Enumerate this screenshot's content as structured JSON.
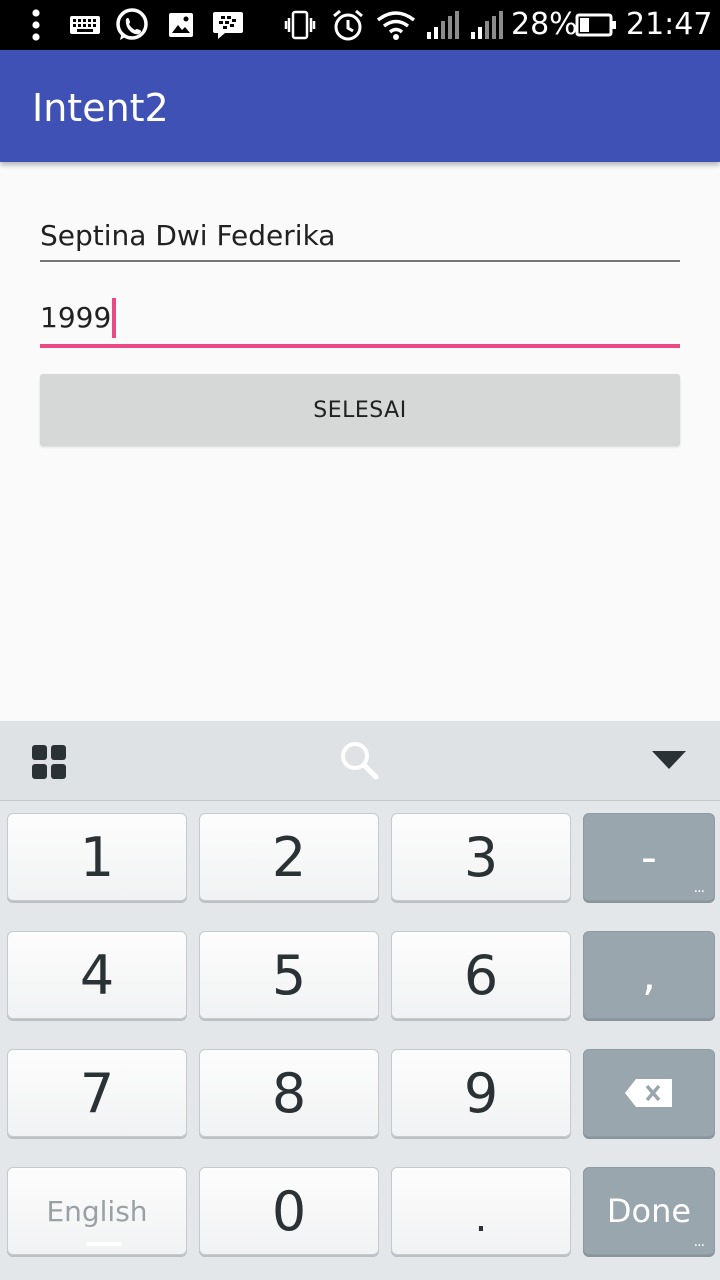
{
  "status_bar": {
    "battery_percent": "28%",
    "time": "21:47",
    "icons": [
      "more-vert-icon",
      "keyboard-icon",
      "whatsapp-icon",
      "gallery-icon",
      "bbm-icon",
      "vibrate-icon",
      "alarm-icon",
      "wifi-icon",
      "signal-icon",
      "signal-icon",
      "battery-icon"
    ]
  },
  "app_bar": {
    "title": "Intent2"
  },
  "form": {
    "name_value": "Septina Dwi Federika",
    "year_value": "1999",
    "submit_label": "SELESAI"
  },
  "keyboard": {
    "toolbar_icons": [
      "grid-icon",
      "search-icon",
      "hide-keyboard-icon"
    ],
    "rows": [
      [
        "1",
        "2",
        "3",
        "-"
      ],
      [
        "4",
        "5",
        "6",
        ","
      ],
      [
        "7",
        "8",
        "9",
        "backspace"
      ],
      [
        "English",
        "0",
        ".",
        "Done"
      ]
    ],
    "more_indicator": "...",
    "accent_color": "#e94a86"
  },
  "colors": {
    "app_bar": "#3f51b5",
    "accent": "#e94a86",
    "button_bg": "#d6d7d7"
  }
}
